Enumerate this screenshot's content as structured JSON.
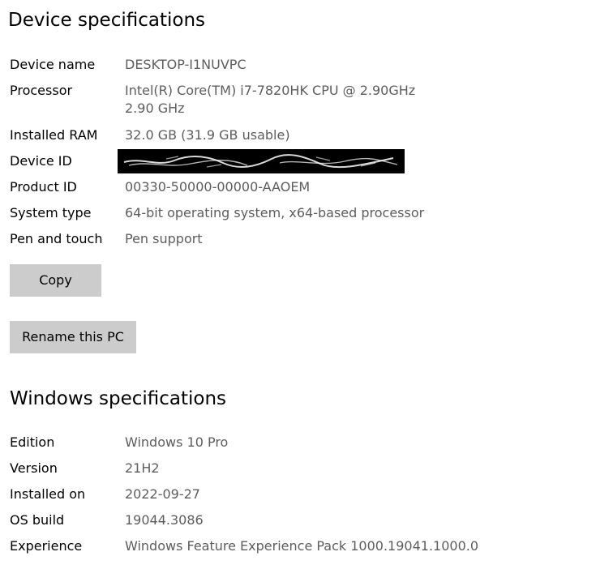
{
  "device_specs": {
    "title": "Device specifications",
    "rows": [
      {
        "label": "Device name",
        "value": "DESKTOP-I1NUVPC"
      },
      {
        "label": "Processor",
        "value": "Intel(R) Core(TM) i7-7820HK CPU @ 2.90GHz   2.90 GHz"
      },
      {
        "label": "Installed RAM",
        "value": "32.0 GB (31.9 GB usable)"
      },
      {
        "label": "Device ID",
        "value": ""
      },
      {
        "label": "Product ID",
        "value": "00330-50000-00000-AAOEM"
      },
      {
        "label": "System type",
        "value": "64-bit operating system, x64-based processor"
      },
      {
        "label": "Pen and touch",
        "value": "Pen support"
      }
    ],
    "copy_button": "Copy",
    "rename_button": "Rename this PC"
  },
  "windows_specs": {
    "title": "Windows specifications",
    "rows": [
      {
        "label": "Edition",
        "value": "Windows 10 Pro"
      },
      {
        "label": "Version",
        "value": "21H2"
      },
      {
        "label": "Installed on",
        "value": "2022-09-27"
      },
      {
        "label": "OS build",
        "value": "19044.3086"
      },
      {
        "label": "Experience",
        "value": "Windows Feature Experience Pack 1000.19041.1000.0"
      }
    ]
  },
  "colors": {
    "label_text": "#000000",
    "value_text": "#5d5d5d",
    "button_bg": "#cccccc",
    "redaction": "#000000"
  }
}
